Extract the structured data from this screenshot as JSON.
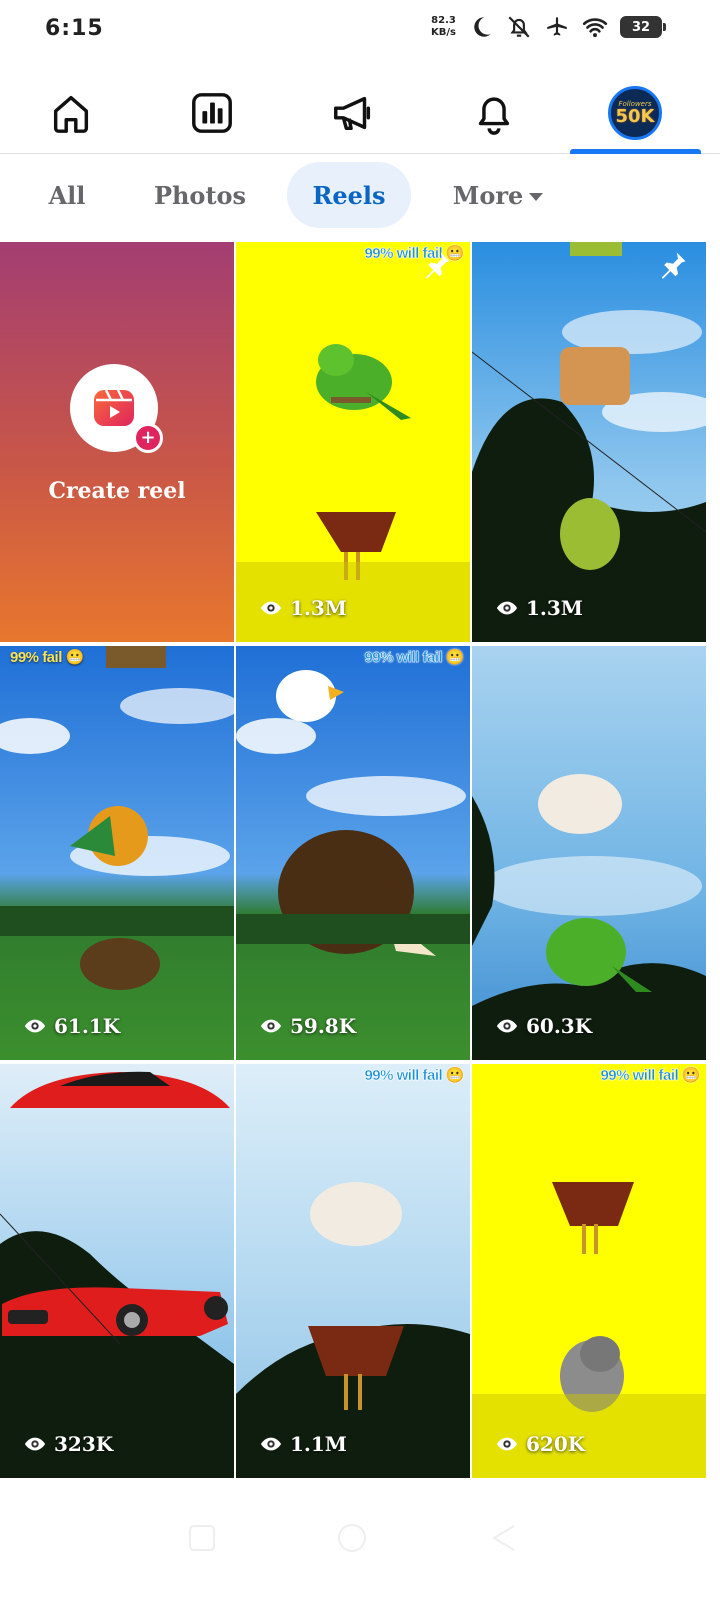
{
  "status_bar": {
    "time": "6:15",
    "net_speed_value": "82.3",
    "net_speed_unit": "KB/s",
    "battery": "32",
    "icons": [
      "moon-icon",
      "bell-off-icon",
      "airplane-icon",
      "wifi-icon",
      "battery-icon"
    ]
  },
  "top_nav": {
    "items": [
      "home-icon",
      "insights-icon",
      "megaphone-icon",
      "notifications-icon",
      "profile-avatar"
    ],
    "active": "profile-avatar",
    "avatar_text_small": "Followers",
    "avatar_text_big": "50K"
  },
  "filter_tabs": {
    "all": "All",
    "photos": "Photos",
    "reels": "Reels",
    "more": "More",
    "active": "Reels"
  },
  "grid": {
    "create_reel_label": "Create reel",
    "tiles": [
      {
        "views": "1.3M",
        "caption": "99% will fail",
        "pinned": true
      },
      {
        "views": "1.3M",
        "caption": "",
        "pinned": true
      },
      {
        "views": "61.1K",
        "caption": "99% fail",
        "pinned": false
      },
      {
        "views": "59.8K",
        "caption": "99% will fail",
        "pinned": false
      },
      {
        "views": "60.3K",
        "caption": "",
        "pinned": false
      },
      {
        "views": "323K",
        "caption": "",
        "pinned": false
      },
      {
        "views": "1.1M",
        "caption": "99% will fail",
        "pinned": false
      },
      {
        "views": "620K",
        "caption": "99% will fail",
        "pinned": false
      }
    ]
  },
  "colors": {
    "accent": "#1877f2",
    "active_tab_bg": "#e7f0fb",
    "active_tab_text": "#0a66c2",
    "tab_text": "#65676b",
    "yellow_bg": "#ffff00"
  }
}
